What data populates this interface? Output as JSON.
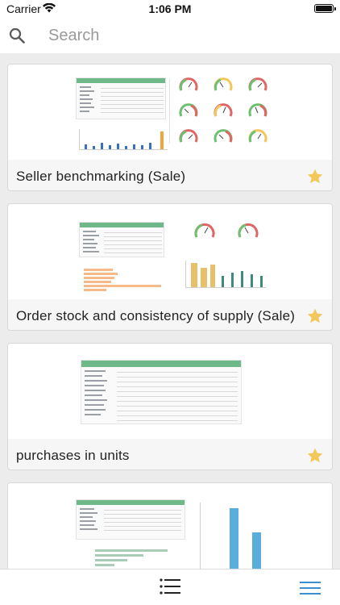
{
  "status_bar": {
    "carrier": "Carrier",
    "time": "1:06 PM"
  },
  "search": {
    "placeholder": "Search",
    "value": ""
  },
  "reports": [
    {
      "title": "Seller benchmarking (Sale)",
      "favorite": true
    },
    {
      "title": "Order stock and consistency of supply (Sale)",
      "favorite": true
    },
    {
      "title": "purchases in units",
      "favorite": true
    },
    {
      "title": "",
      "favorite": false
    }
  ],
  "colors": {
    "star": "#f2c85b",
    "accent": "#3a8fd0",
    "table_header": "#6fb88a"
  },
  "icons": {
    "search": "search-icon",
    "wifi": "wifi-icon",
    "battery": "battery-icon",
    "star": "star-icon",
    "list": "list-icon",
    "menu": "menu-icon"
  }
}
